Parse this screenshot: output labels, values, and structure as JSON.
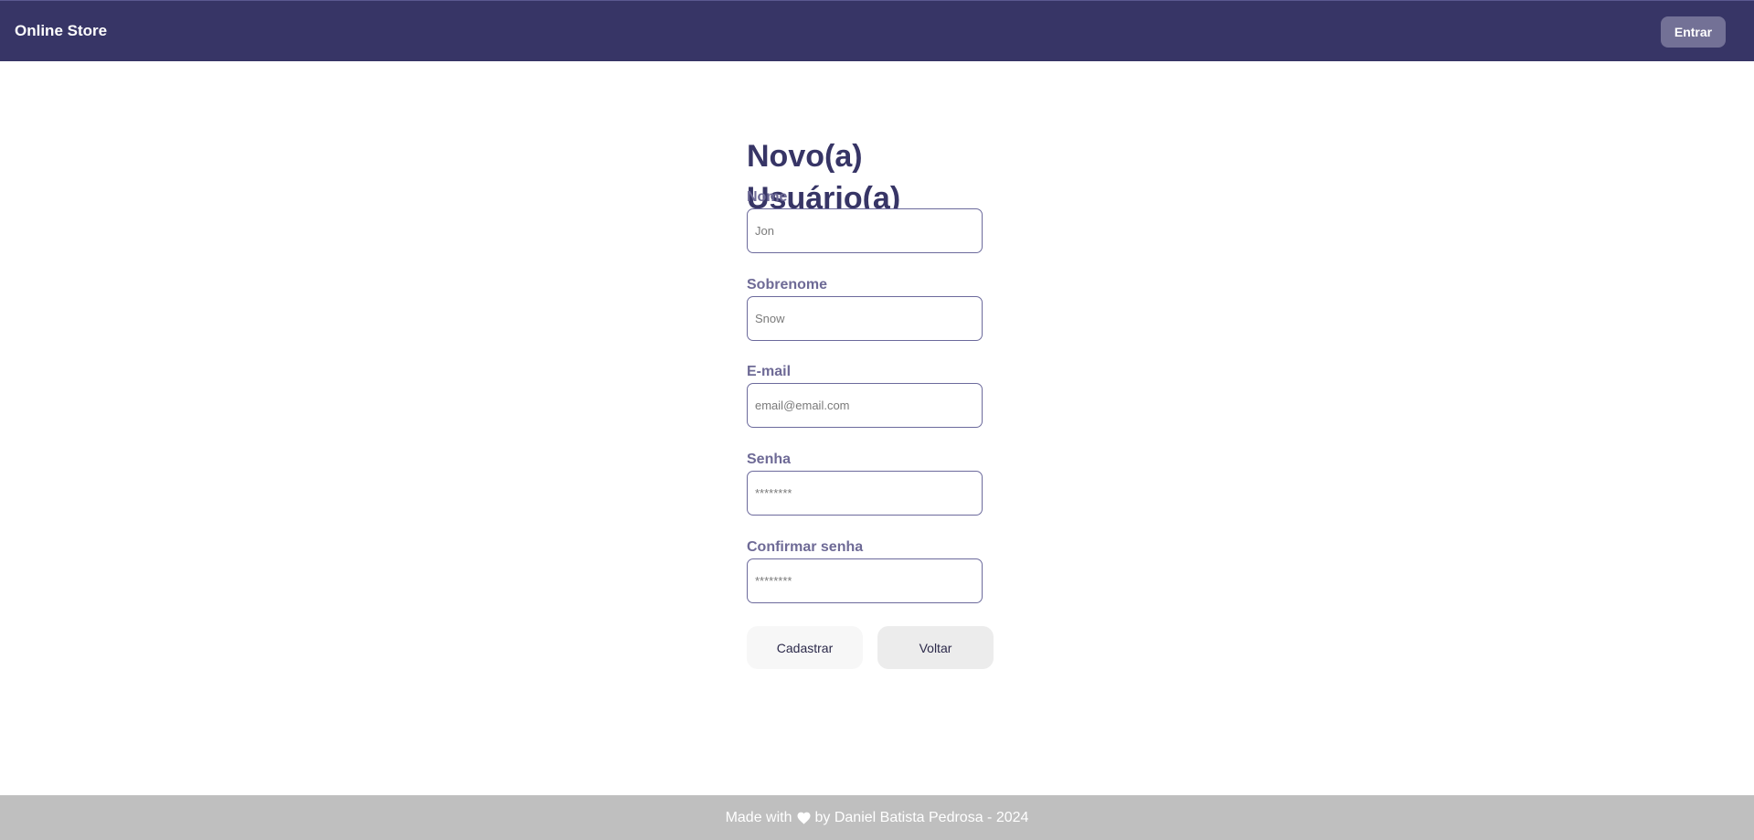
{
  "header": {
    "brand": "Online Store",
    "login_label": "Entrar"
  },
  "form": {
    "title": "Novo(a) Usuário(a)",
    "fields": [
      {
        "label": "Nome",
        "placeholder": "Jon"
      },
      {
        "label": "Sobrenome",
        "placeholder": "Snow"
      },
      {
        "label": "E-mail",
        "placeholder": "email@email.com"
      },
      {
        "label": "Senha",
        "placeholder": "********"
      },
      {
        "label": "Confirmar senha",
        "placeholder": "********"
      }
    ],
    "submit_label": "Cadastrar",
    "back_label": "Voltar"
  },
  "footer": {
    "made_with": "Made with",
    "heart_icon": "heart-icon",
    "by_text": "by Daniel Batista Pedrosa - 2024"
  },
  "colors": {
    "navbar": "#373566",
    "accent_text": "#373566",
    "label_text": "#6e6a96",
    "footer": "#bfbfbf"
  }
}
